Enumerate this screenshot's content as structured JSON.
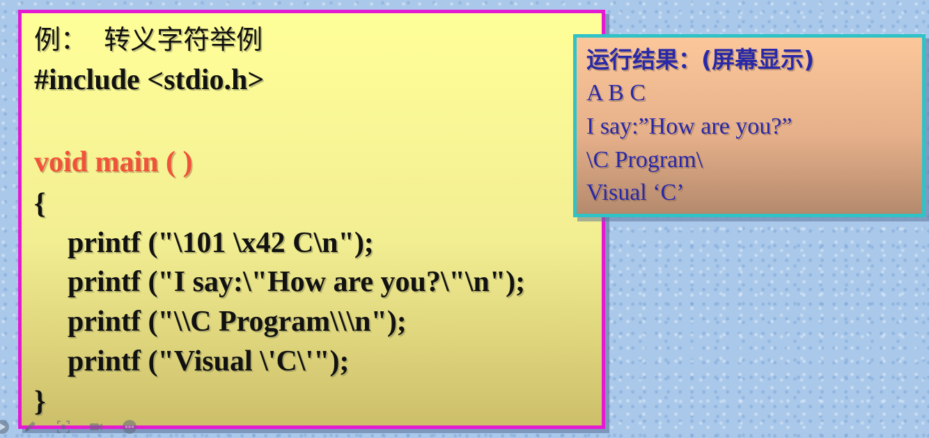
{
  "code_panel": {
    "title": "例：  转义字符举例",
    "lines": [
      "#include <stdio.h>",
      "void main ( )",
      "{",
      "printf (\"\\101 \\x42 C\\n\");",
      "printf (\"I say:\\\"How are you?\\\"\\n\");",
      "printf (\"\\\\C Program\\\\\\n\");",
      "printf (\"Visual \\'C\\'\");",
      "}"
    ],
    "colors": {
      "border": "#e41ad3",
      "highlight": "#f0523a",
      "text": "#111111"
    }
  },
  "result_panel": {
    "heading": "运行结果：(屏幕显示)",
    "lines": [
      "A B C",
      "I say:”How are you?”",
      "\\C Program\\",
      "Visual ‘C’"
    ],
    "colors": {
      "border": "#2fc2c7",
      "text": "#2828a8"
    }
  },
  "toolbar": {
    "icons": [
      "play-icon",
      "pen-icon",
      "zoom-icon",
      "camera-icon",
      "more-icon"
    ]
  }
}
